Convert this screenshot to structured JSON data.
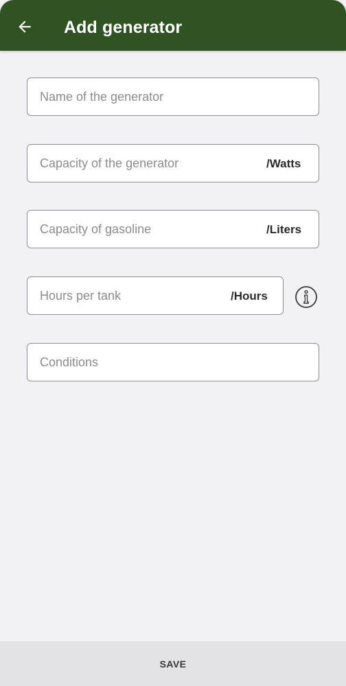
{
  "app_bar": {
    "title": "Add generator",
    "back_icon": "arrow-left-icon",
    "background_color": "#2f5323"
  },
  "form": {
    "name_field": {
      "placeholder": "Name of the generator",
      "value": ""
    },
    "capacity_field": {
      "placeholder": "Capacity of the generator",
      "value": "",
      "unit": "/Watts"
    },
    "gasoline_field": {
      "placeholder": "Capacity of gasoline",
      "value": "",
      "unit": "/Liters"
    },
    "hours_field": {
      "placeholder": "Hours per tank",
      "value": "",
      "unit": "/Hours"
    },
    "info_icon": "info-circle-icon",
    "conditions_field": {
      "placeholder": "Conditions",
      "value": ""
    }
  },
  "footer": {
    "save_label": "SAVE"
  }
}
